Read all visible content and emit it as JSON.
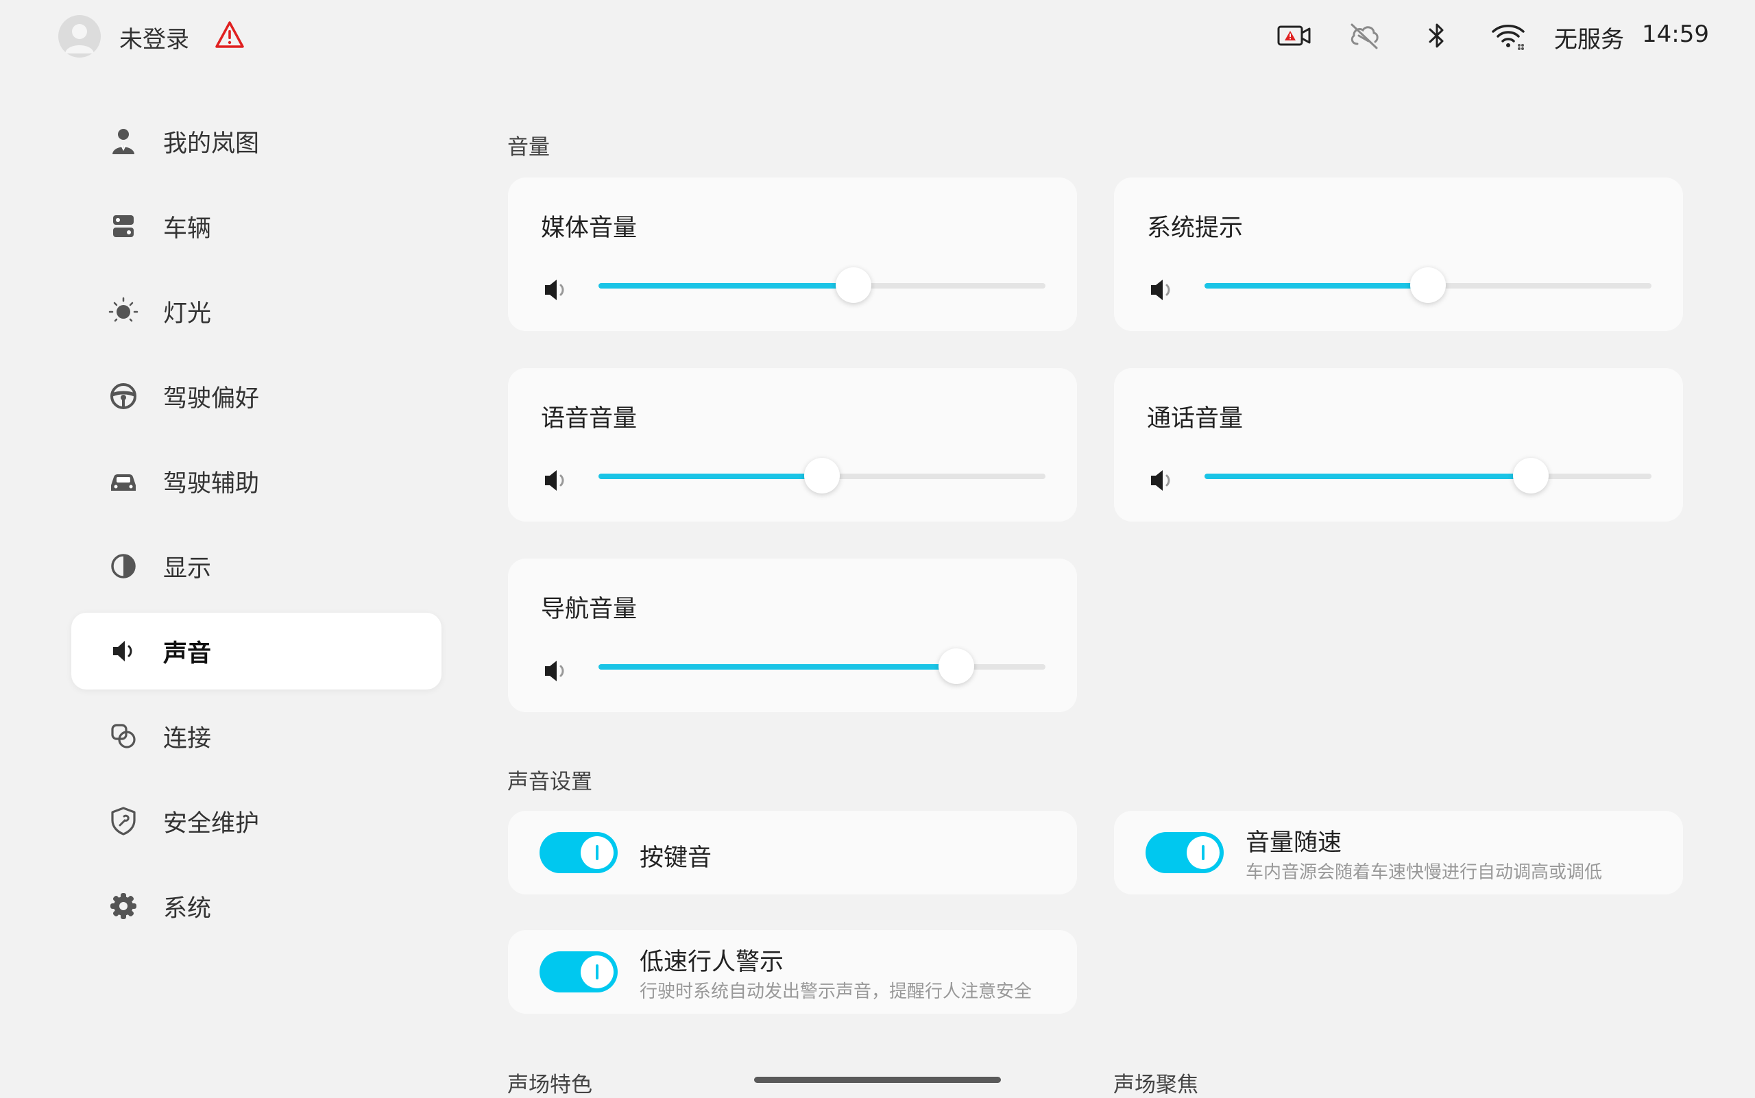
{
  "status_bar": {
    "account_label": "未登录",
    "service_label": "无服务",
    "clock": "14:59",
    "icons": [
      "avatar-icon",
      "warning-icon",
      "dashcam-alert-icon",
      "cloud-off-icon",
      "bluetooth-icon",
      "wifi-icon"
    ],
    "warning_color": "#e02020"
  },
  "sidebar": {
    "active_index": 6,
    "items": [
      {
        "label": "我的岚图",
        "icon": "user-icon"
      },
      {
        "label": "车辆",
        "icon": "vehicle-icon"
      },
      {
        "label": "灯光",
        "icon": "light-icon"
      },
      {
        "label": "驾驶偏好",
        "icon": "steering-wheel-icon"
      },
      {
        "label": "驾驶辅助",
        "icon": "car-front-icon"
      },
      {
        "label": "显示",
        "icon": "contrast-icon"
      },
      {
        "label": "声音",
        "icon": "speaker-icon"
      },
      {
        "label": "连接",
        "icon": "link-icon"
      },
      {
        "label": "安全维护",
        "icon": "shield-icon"
      },
      {
        "label": "系统",
        "icon": "gear-icon"
      }
    ]
  },
  "volume": {
    "section_title": "音量",
    "accent_color": "#1ac4e6",
    "sliders": [
      {
        "label": "媒体音量",
        "level_percent": 57
      },
      {
        "label": "系统提示",
        "level_percent": 50
      },
      {
        "label": "语音音量",
        "level_percent": 50
      },
      {
        "label": "通话音量",
        "level_percent": 73
      },
      {
        "label": "导航音量",
        "level_percent": 80
      }
    ]
  },
  "sound_settings": {
    "section_title": "声音设置",
    "toggles": [
      {
        "label": "按键音",
        "description": "",
        "on": true
      },
      {
        "label": "音量随速",
        "description": "车内音源会随着车速快慢进行自动调高或调低",
        "on": true
      },
      {
        "label": "低速行人警示",
        "description": "行驶时系统自动发出警示声音，提醒行人注意安全",
        "on": true
      }
    ]
  },
  "sound_field": {
    "character_title": "声场特色",
    "focus_title": "声场聚焦"
  }
}
